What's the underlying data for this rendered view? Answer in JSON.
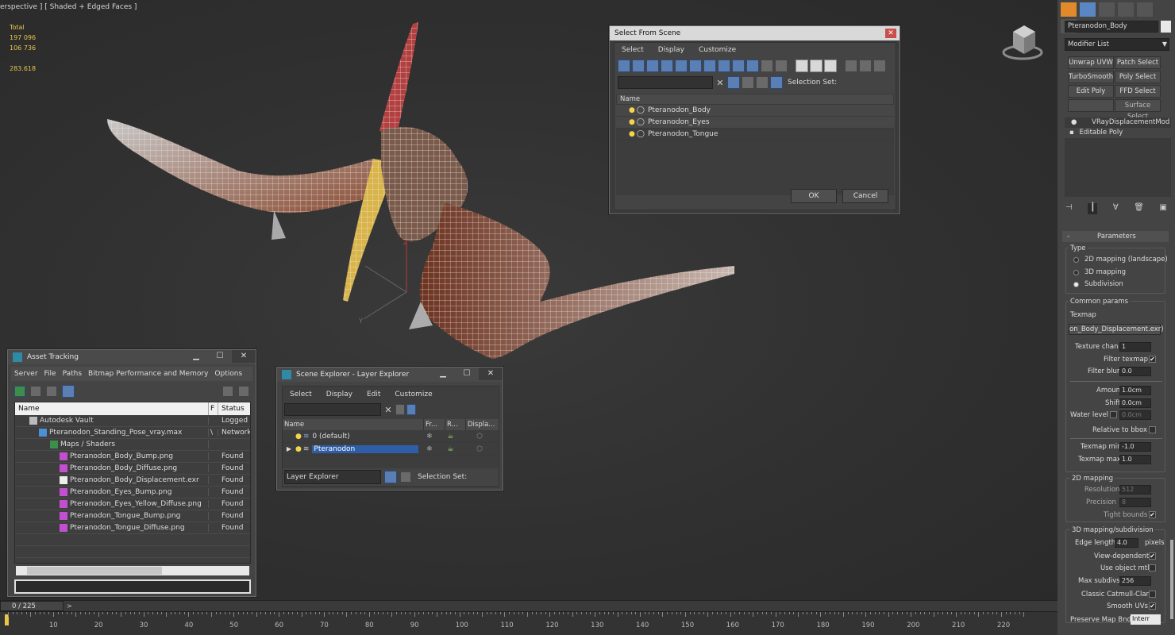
{
  "viewport": {
    "label": "erspective ] [ Shaded + Edged Faces ]",
    "stats": {
      "total_label": "Total",
      "polys": "197 096",
      "verts": "106 736",
      "fps": "283.618"
    }
  },
  "select_dialog": {
    "title": "Select From Scene",
    "menu": [
      "Select",
      "Display",
      "Customize"
    ],
    "selection_set_label": "Selection Set:",
    "col_name": "Name",
    "items": [
      "Pteranodon_Body",
      "Pteranodon_Eyes",
      "Pteranodon_Tongue"
    ],
    "ok": "OK",
    "cancel": "Cancel"
  },
  "asset_tracking": {
    "title": "Asset Tracking",
    "menu": [
      "Server",
      "File",
      "Paths",
      "Bitmap Performance and Memory",
      "Options"
    ],
    "col_name": "Name",
    "col_f": "F",
    "col_status": "Status",
    "rows": [
      {
        "name": "Autodesk Vault",
        "f": "",
        "status": "Logged"
      },
      {
        "name": "Pteranodon_Standing_Pose_vray.max",
        "f": "\\",
        "status": "Network"
      },
      {
        "name": "Maps / Shaders",
        "f": "",
        "status": ""
      },
      {
        "name": "Pteranodon_Body_Bump.png",
        "f": "",
        "status": "Found"
      },
      {
        "name": "Pteranodon_Body_Diffuse.png",
        "f": "",
        "status": "Found"
      },
      {
        "name": "Pteranodon_Body_Displacement.exr",
        "f": "",
        "status": "Found"
      },
      {
        "name": "Pteranodon_Eyes_Bump.png",
        "f": "",
        "status": "Found"
      },
      {
        "name": "Pteranodon_Eyes_Yellow_Diffuse.png",
        "f": "",
        "status": "Found"
      },
      {
        "name": "Pteranodon_Tongue_Bump.png",
        "f": "",
        "status": "Found"
      },
      {
        "name": "Pteranodon_Tongue_Diffuse.png",
        "f": "",
        "status": "Found"
      }
    ]
  },
  "scene_explorer": {
    "title": "Scene Explorer - Layer Explorer",
    "menu": [
      "Select",
      "Display",
      "Edit",
      "Customize"
    ],
    "col_name": "Name",
    "col_fr": "Fr...",
    "col_r": "R...",
    "col_disp": "Displa...",
    "layers": [
      "0 (default)",
      "Pteranodon"
    ],
    "footer_select": "Layer Explorer",
    "selection_set_label": "Selection Set:"
  },
  "command_panel": {
    "object_name": "Pteranodon_Body",
    "modifier_list": "Modifier List",
    "mod_buttons": [
      "Unwrap UVW",
      "Patch Select",
      "TurboSmooth",
      "Poly Select",
      "Edit Poly",
      "FFD Select",
      "",
      "Surface Select"
    ],
    "stack": [
      "VRayDisplacementMod",
      "Editable Poly"
    ],
    "rollout": "Parameters",
    "type_label": "Type",
    "types": [
      "2D mapping (landscape)",
      "3D mapping",
      "Subdivision"
    ],
    "common_params": "Common params",
    "texmap_label": "Texmap",
    "texmap_value": "on_Body_Displacement.exr)",
    "texture_chan": {
      "label": "Texture chan",
      "value": "1"
    },
    "filter_texmap": "Filter texmap",
    "filter_blur": {
      "label": "Filter blur",
      "value": "0.0"
    },
    "amount": {
      "label": "Amount",
      "value": "1.0cm"
    },
    "shift": {
      "label": "Shift",
      "value": "0.0cm"
    },
    "water_level": {
      "label": "Water level",
      "value": "0.0cm"
    },
    "relative_bbox": "Relative to bbox",
    "texmap_min": {
      "label": "Texmap min",
      "value": "-1.0"
    },
    "texmap_max": {
      "label": "Texmap max",
      "value": "1.0"
    },
    "mapping2d": "2D mapping",
    "resolution": {
      "label": "Resolution",
      "value": "512"
    },
    "precision": {
      "label": "Precision",
      "value": "8"
    },
    "tight_bounds": "Tight bounds",
    "mapping3d": "3D mapping/subdivision",
    "edge_length": {
      "label": "Edge length",
      "value": "4.0",
      "unit": "pixels"
    },
    "view_dependent": "View-dependent",
    "use_object_mtl": "Use object mtl",
    "max_subdivs": {
      "label": "Max subdivs",
      "value": "256"
    },
    "classic_catmull": "Classic Catmull-Clark",
    "smooth_uvs": "Smooth UVs",
    "preserve_map": {
      "label": "Preserve Map Bnd",
      "value": "Interr"
    }
  },
  "timeline": {
    "frame": "0 / 225",
    "ticks": [
      "10",
      "20",
      "30",
      "40",
      "50",
      "60",
      "70",
      "80",
      "90",
      "100",
      "110",
      "120",
      "130",
      "140",
      "150",
      "160",
      "170",
      "180",
      "190",
      "200",
      "210",
      "220"
    ]
  },
  "colors": {
    "accent": "#2f5ea8",
    "stat_text": "#e8c64a",
    "panel": "#444444"
  }
}
